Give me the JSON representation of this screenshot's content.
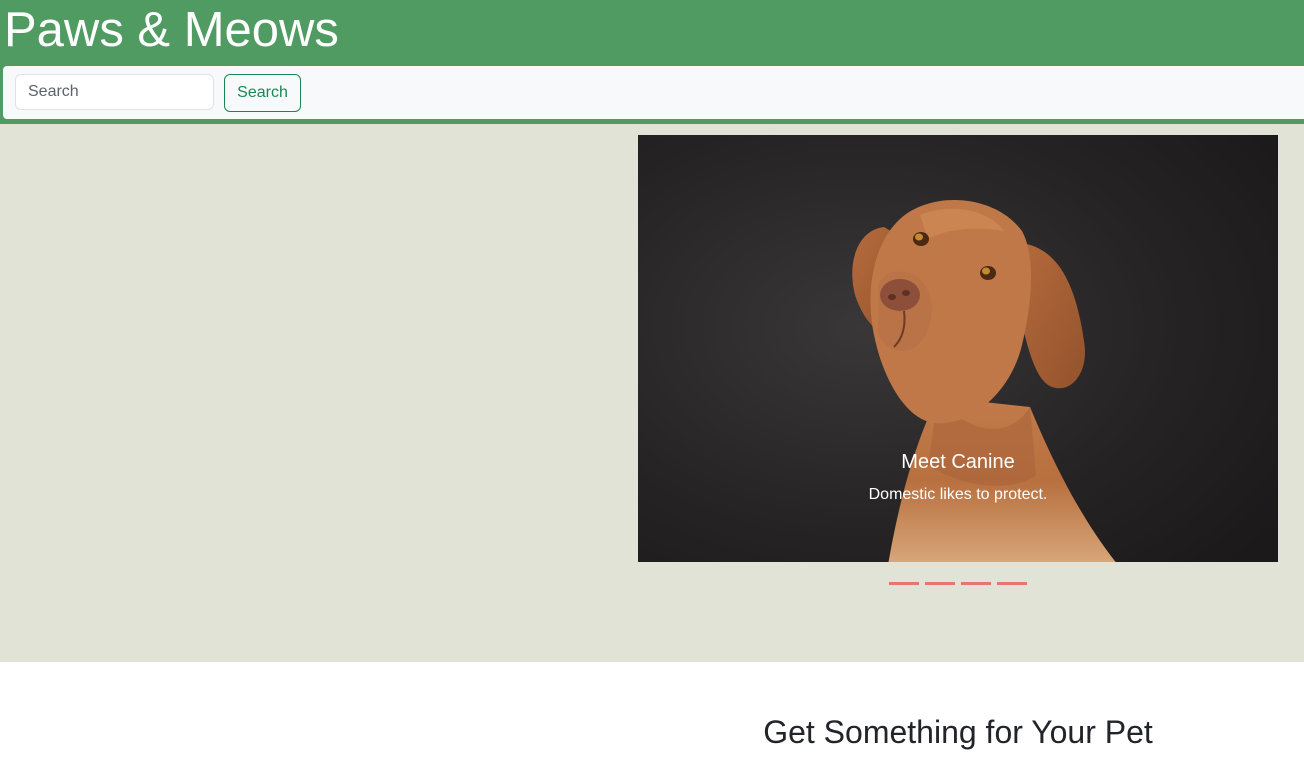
{
  "header": {
    "title": "Paws & Meows",
    "background": "#4f9b62"
  },
  "search": {
    "placeholder": "Search",
    "value": "",
    "button_label": "Search",
    "button_color": "#198754"
  },
  "hero": {
    "background": "#e2e3d7",
    "carousel": {
      "image": "dog-portrait",
      "caption_title": "Meet Canine",
      "caption_text": "Domestic likes to protect.",
      "indicator_count": 4,
      "indicator_color": "#e8766c"
    }
  },
  "section": {
    "heading": "Get Something for Your Pet"
  }
}
